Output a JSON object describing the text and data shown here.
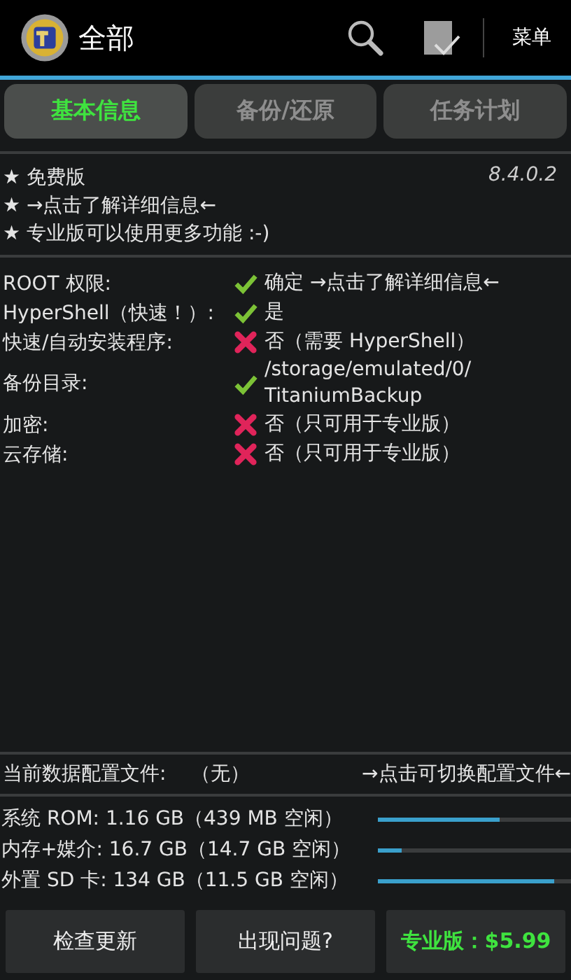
{
  "action_bar": {
    "title": "全部",
    "menu": "菜单"
  },
  "tabs": [
    {
      "label": "基本信息",
      "selected": true
    },
    {
      "label": "备份/还原",
      "selected": false
    },
    {
      "label": "任务计划",
      "selected": false
    }
  ],
  "info": {
    "lines": [
      "★ 免费版",
      "★ →点击了解详细信息←",
      "★ 专业版可以使用更多功能 :-)"
    ],
    "version": "8.4.0.2"
  },
  "status": [
    {
      "label": "ROOT 权限:",
      "ok": true,
      "value": [
        "确定 →点击了解详细信息←"
      ]
    },
    {
      "label": "HyperShell（快速！）:",
      "ok": true,
      "value": [
        "是"
      ]
    },
    {
      "label": "快速/自动安装程序:",
      "ok": false,
      "value": [
        "否（需要 HyperShell）"
      ]
    },
    {
      "label": "备份目录:",
      "ok": true,
      "value": [
        "/storage/emulated/0/",
        "TitaniumBackup"
      ]
    },
    {
      "label": "加密:",
      "ok": false,
      "value": [
        "否（只可用于专业版）"
      ]
    },
    {
      "label": "云存储:",
      "ok": false,
      "value": [
        "否（只可用于专业版）"
      ]
    }
  ],
  "profile": {
    "label": "当前数据配置文件:",
    "value": "（无）",
    "link": "→点击可切换配置文件←"
  },
  "storage": [
    {
      "text": "系统 ROM:  1.16 GB（439 MB 空闲）",
      "level": 0.63
    },
    {
      "text": "内存+媒介: 16.7 GB（14.7 GB 空闲）",
      "level": 0.12
    },
    {
      "text": "外置 SD 卡: 134 GB（11.5 GB 空闲）",
      "level": 0.91
    }
  ],
  "buttons": [
    {
      "label": "检查更新",
      "kind": "plain"
    },
    {
      "label": "出现问题?",
      "kind": "plain"
    },
    {
      "label": "专业版：$5.99",
      "kind": "pro"
    }
  ]
}
